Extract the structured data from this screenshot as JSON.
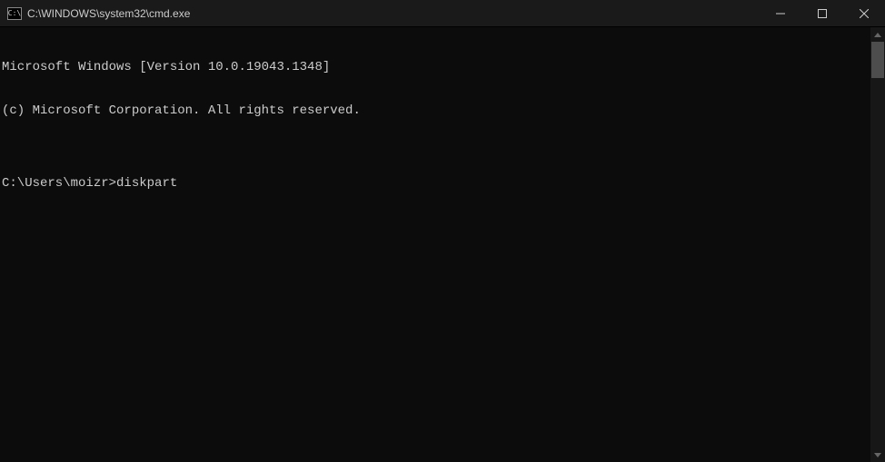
{
  "titlebar": {
    "icon_text": "C:\\",
    "title": "C:\\WINDOWS\\system32\\cmd.exe"
  },
  "terminal": {
    "line1": "Microsoft Windows [Version 10.0.19043.1348]",
    "line2": "(c) Microsoft Corporation. All rights reserved.",
    "blank": "",
    "prompt": "C:\\Users\\moizr>",
    "command": "diskpart"
  }
}
